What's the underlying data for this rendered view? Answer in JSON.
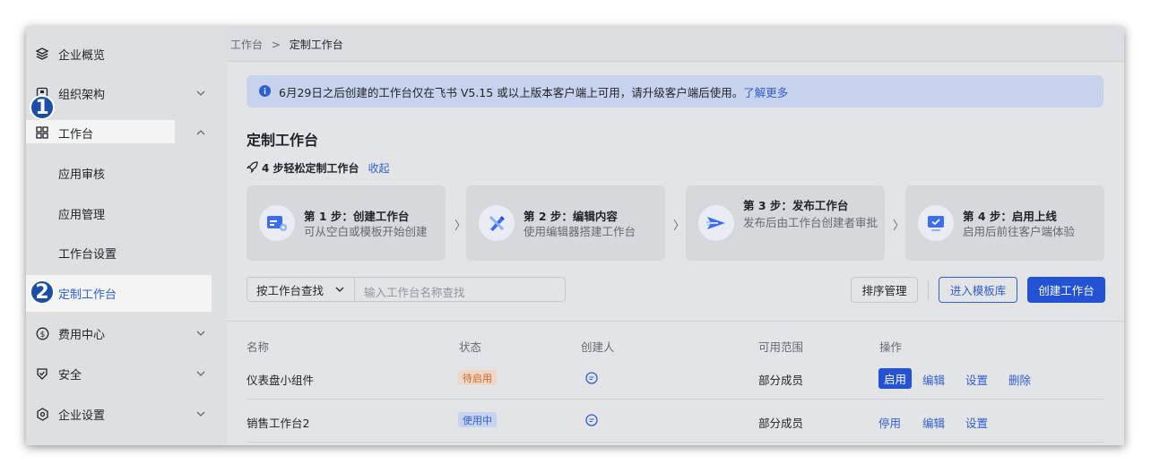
{
  "sidebar": {
    "items": [
      {
        "label": "企业概览",
        "icon": "layers-icon"
      },
      {
        "label": "组织架构",
        "icon": "org-icon"
      },
      {
        "label": "工作台",
        "icon": "grid-icon"
      },
      {
        "label": "应用审核"
      },
      {
        "label": "应用管理"
      },
      {
        "label": "工作台设置"
      },
      {
        "label": "定制工作台"
      },
      {
        "label": "费用中心",
        "icon": "dollar-icon"
      },
      {
        "label": "安全",
        "icon": "shield-icon"
      },
      {
        "label": "企业设置",
        "icon": "hexagon-icon"
      }
    ],
    "markers": [
      "1",
      "2"
    ]
  },
  "breadcrumb": {
    "root": "工作台",
    "sep": ">",
    "current": "定制工作台"
  },
  "notice": {
    "text": "6月29日之后创建的工作台仅在飞书 V5.15 或以上版本客户端上可用，请升级客户端后使用。",
    "link": "了解更多"
  },
  "page": {
    "title": "定制工作台"
  },
  "guide": {
    "title": "4 步轻松定制工作台",
    "collapse": "收起"
  },
  "steps": [
    {
      "title": "第 1 步：创建工作台",
      "desc": "可从空白或模板开始创建"
    },
    {
      "title": "第 2 步：编辑内容",
      "desc": "使用编辑器搭建工作台"
    },
    {
      "title": "第 3 步：发布工作台",
      "desc": "发布后由工作台创建者审批"
    },
    {
      "title": "第 4 步：启用上线",
      "desc": "启用后前往客户端体验"
    }
  ],
  "toolbar": {
    "filter_select": "按工作台查找",
    "search_placeholder": "输入工作台名称查找",
    "sort_btn": "排序管理",
    "template_btn": "进入模板库",
    "create_btn": "创建工作台"
  },
  "table": {
    "headers": [
      "名称",
      "状态",
      "创建人",
      "可用范围",
      "操作"
    ],
    "rows": [
      {
        "name": "仪表盘小组件",
        "status": "待启用",
        "scope": "部分成员",
        "actions": [
          "启用",
          "编辑",
          "设置",
          "删除"
        ]
      },
      {
        "name": "销售工作台2",
        "status": "使用中",
        "scope": "部分成员",
        "actions": [
          "停用",
          "编辑",
          "设置"
        ]
      }
    ]
  },
  "colors": {
    "accent": "#2353d4",
    "link": "#2f5fd0",
    "marker": "#1b4ea8"
  }
}
